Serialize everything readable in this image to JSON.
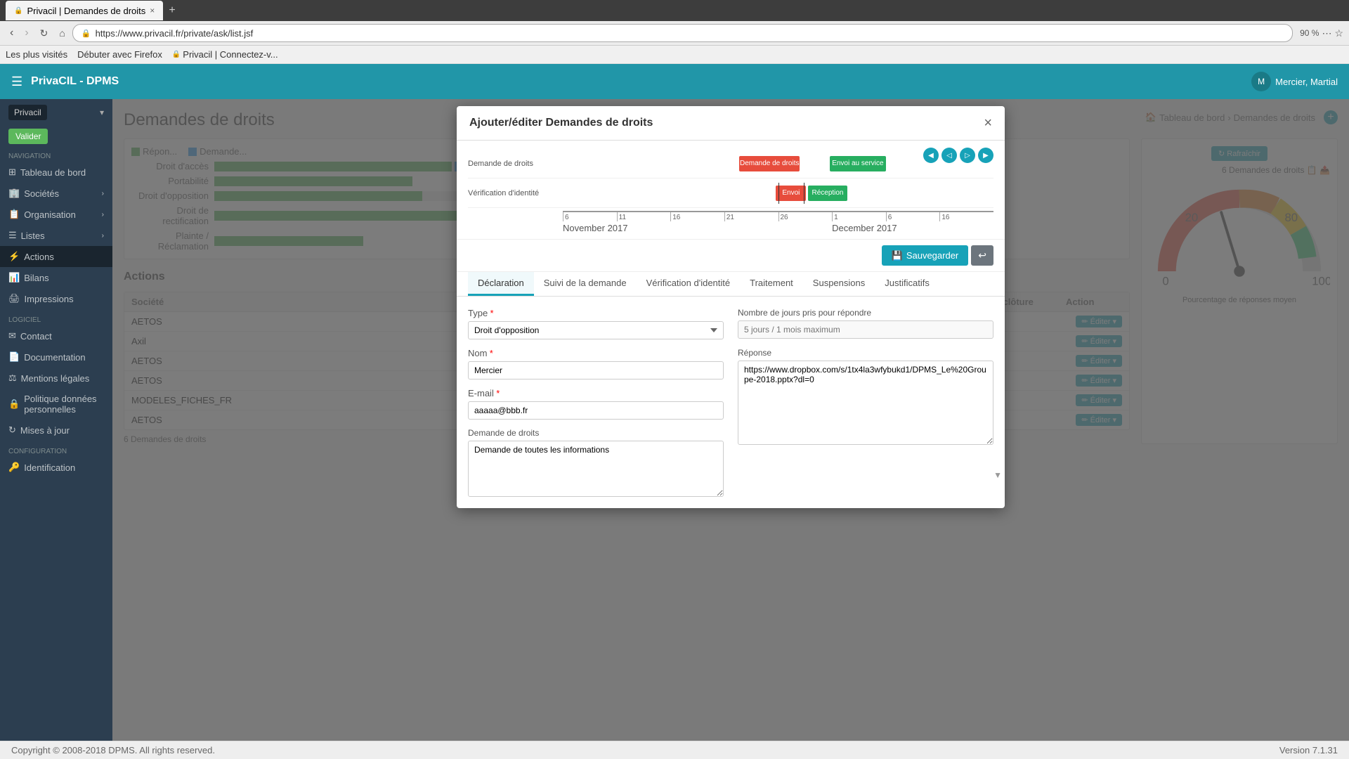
{
  "browser": {
    "tab_title": "Privacil | Demandes de droits",
    "url": "https://www.privacil.fr/private/ask/list.jsf",
    "zoom": "90 %",
    "bookmarks": [
      "Les plus visités",
      "Débuter avec Firefox",
      "Privacil | Connectez-v..."
    ]
  },
  "header": {
    "logo": "PrivaCIL - DPMS",
    "hamburger": "☰",
    "user": "Mercier, Martial"
  },
  "sidebar": {
    "brand": "Privacil",
    "validate_label": "Valider",
    "sections": {
      "navigation": "Navigation",
      "logiciel": "Logiciel",
      "configuration": "Configuration"
    },
    "items": [
      {
        "label": "Tableau de bord",
        "icon": "⊞",
        "has_arrow": false
      },
      {
        "label": "Sociétés",
        "icon": "🏢",
        "has_arrow": true
      },
      {
        "label": "Organisation",
        "icon": "📋",
        "has_arrow": true
      },
      {
        "label": "Listes",
        "icon": "☰",
        "has_arrow": true
      },
      {
        "label": "Actions",
        "icon": "⚡",
        "has_arrow": false
      },
      {
        "label": "Bilans",
        "icon": "📊",
        "has_arrow": false
      },
      {
        "label": "Impressions",
        "icon": "🖨",
        "has_arrow": false
      },
      {
        "label": "Contact",
        "icon": "✉",
        "has_arrow": false
      },
      {
        "label": "Documentation",
        "icon": "📄",
        "has_arrow": false
      },
      {
        "label": "Mentions légales",
        "icon": "⚖",
        "has_arrow": false
      },
      {
        "label": "Politique données personnelles",
        "icon": "🔒",
        "has_arrow": false
      },
      {
        "label": "Mises à jour",
        "icon": "↻",
        "has_arrow": false
      },
      {
        "label": "Identification",
        "icon": "🔑",
        "has_arrow": false
      }
    ]
  },
  "page": {
    "title": "Demandes de droits",
    "breadcrumb_home": "Tableau de bord",
    "breadcrumb_current": "Demandes de droits",
    "add_icon": "+"
  },
  "modal": {
    "title": "Ajouter/éditer Demandes de droits",
    "close": "×",
    "gantt": {
      "rows": [
        {
          "label": "Demande de droits",
          "bars": [
            {
              "label": "Demande de droits",
              "color": "red",
              "left": "43%",
              "width": "14%"
            },
            {
              "label": "Envoi au service",
              "color": "green",
              "left": "63%",
              "width": "13%"
            }
          ]
        },
        {
          "label": "Vérification d'identité",
          "bars": [
            {
              "label": "Réception",
              "color": "green",
              "left": "58%",
              "width": "9%"
            },
            {
              "label": "Envoi",
              "color": "red",
              "left": "52%",
              "width": "7%"
            }
          ]
        }
      ],
      "ticks": [
        "6",
        "11",
        "16",
        "21",
        "26",
        "1",
        "6",
        "16"
      ],
      "months": [
        "November 2017",
        "December 2017"
      ],
      "nav_buttons": [
        "◀",
        "◁",
        "▷",
        "▶"
      ]
    },
    "save_label": "Sauvegarder",
    "back_icon": "↩",
    "tabs": [
      {
        "label": "Déclaration",
        "active": true
      },
      {
        "label": "Suivi de la demande",
        "active": false
      },
      {
        "label": "Vérification d'identité",
        "active": false
      },
      {
        "label": "Traitement",
        "active": false
      },
      {
        "label": "Suspensions",
        "active": false
      },
      {
        "label": "Justificatifs",
        "active": false
      }
    ],
    "form": {
      "type_label": "Type",
      "type_required": true,
      "type_value": "Droit d'opposition",
      "type_options": [
        "Droit d'accès",
        "Droit d'opposition",
        "Portabilité",
        "Droit de rectification",
        "Plainte / Réclamation"
      ],
      "nom_label": "Nom",
      "nom_required": true,
      "nom_value": "Mercier",
      "email_label": "E-mail",
      "email_required": true,
      "email_value": "aaaaa@bbb.fr",
      "demande_label": "Demande de droits",
      "demande_value": "Demande de toutes les informations",
      "jours_label": "Nombre de jours pris pour répondre",
      "jours_value": "5 jours / 1 mois maximum",
      "reponse_label": "Réponse",
      "reponse_value": "https://www.dropbox.com/s/1tx4la3wfybukd1/DPMS_Le%20Groupe-2018.pptx?dl=0"
    }
  },
  "bg": {
    "chart_rows": [
      {
        "label": "Droit d'accès",
        "values": "Répon... Demande..."
      },
      {
        "label": "Portabilité",
        "values": ""
      },
      {
        "label": "Droit d'opposition",
        "values": ""
      },
      {
        "label": "Droit de rectification",
        "values": ""
      },
      {
        "label": "Plainte / Réclamation",
        "values": ""
      }
    ],
    "table_companies": [
      "AETOS",
      "Axil",
      "AETOS",
      "AETOS",
      "MODELES_FICHES_FR",
      "AETOS"
    ],
    "demands_count": "6 Demandes de droits",
    "actions_label": "Actions",
    "edit_label": "Éditer",
    "refresh_label": "Rafraîchir",
    "gauge_label": "Pourcentage de réponses moyen"
  },
  "footer": {
    "copyright": "Copyright © 2008-2018 DPMS. All rights reserved.",
    "version": "Version 7.1.31"
  }
}
